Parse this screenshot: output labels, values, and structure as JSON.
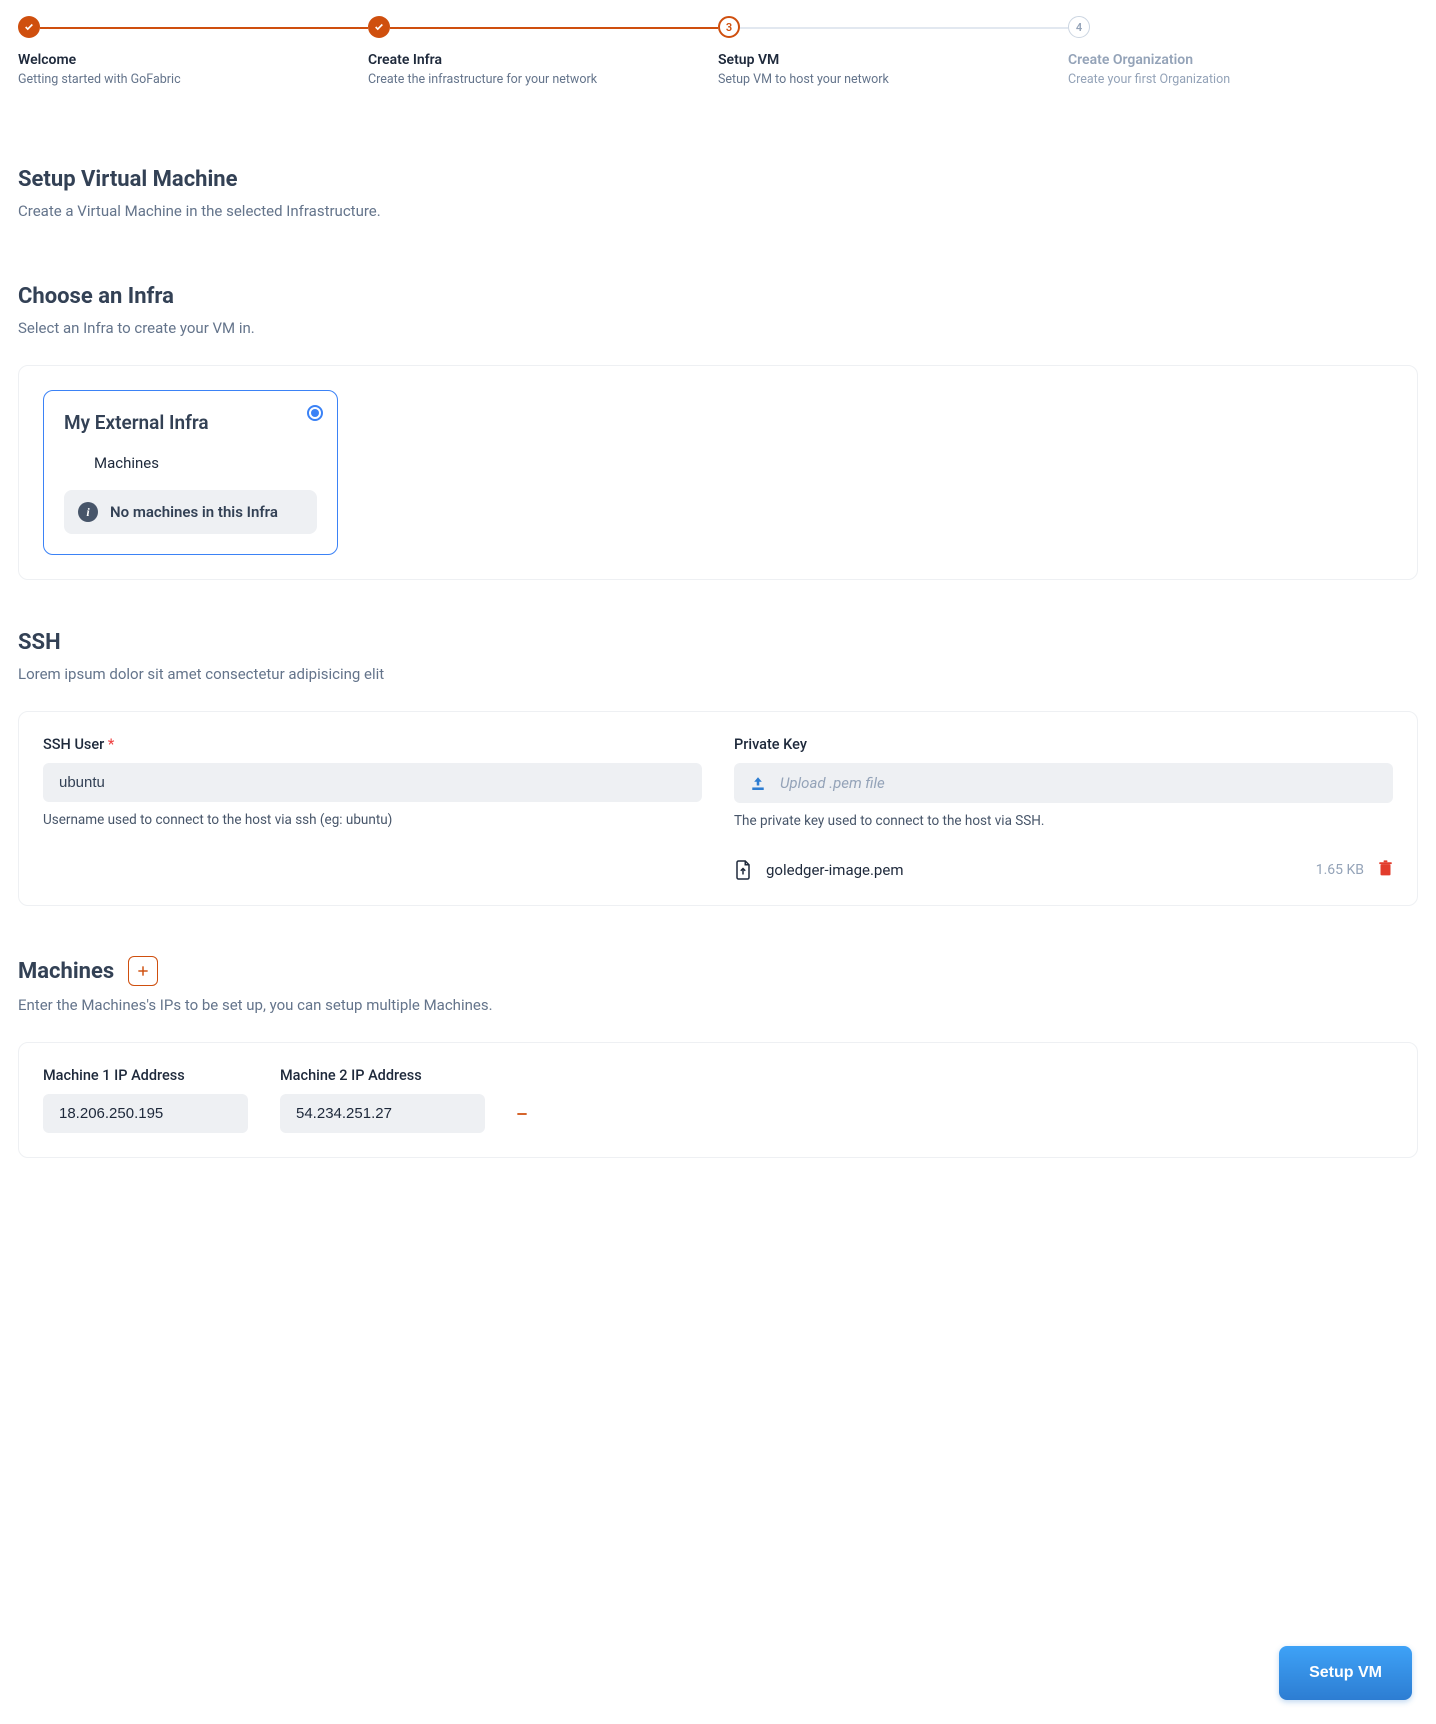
{
  "stepper": [
    {
      "title": "Welcome",
      "sub": "Getting started with GoFabric",
      "state": "done",
      "number": "1"
    },
    {
      "title": "Create Infra",
      "sub": "Create the infrastructure for your network",
      "state": "done",
      "number": "2"
    },
    {
      "title": "Setup VM",
      "sub": "Setup VM to host your network",
      "state": "active",
      "number": "3"
    },
    {
      "title": "Create Organization",
      "sub": "Create your first Organization",
      "state": "pending",
      "number": "4"
    }
  ],
  "setupVM": {
    "title": "Setup Virtual Machine",
    "sub": "Create a Virtual Machine in the selected Infrastructure."
  },
  "chooseInfra": {
    "title": "Choose an Infra",
    "sub": "Select an Infra to create your VM in.",
    "card": {
      "name": "My External Infra",
      "machinesLabel": "Machines",
      "emptyMsg": "No machines in this Infra"
    }
  },
  "ssh": {
    "title": "SSH",
    "sub": "Lorem ipsum dolor sit amet consectetur adipisicing elit",
    "userLabel": "SSH User",
    "userValue": "ubuntu",
    "userHint": "Username used to connect to the host via ssh (eg: ubuntu)",
    "keyLabel": "Private Key",
    "keyPlaceholder": "Upload .pem file",
    "keyHint": "The private key used to connect to the host via SSH.",
    "file": {
      "name": "goledger-image.pem",
      "size": "1.65 KB"
    }
  },
  "machines": {
    "title": "Machines",
    "sub": "Enter the Machines's IPs to be set up, you can setup multiple Machines.",
    "items": [
      {
        "label": "Machine 1 IP Address",
        "ip": "18.206.250.195"
      },
      {
        "label": "Machine 2 IP Address",
        "ip": "54.234.251.27"
      }
    ]
  },
  "cta": "Setup VM"
}
